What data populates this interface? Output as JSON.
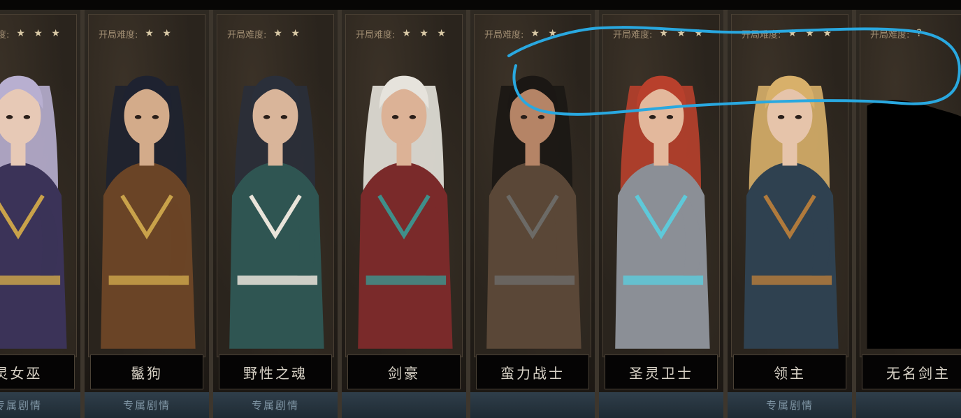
{
  "difficulty_label": "开局难度:",
  "cards": [
    {
      "name": "灵女巫",
      "stars": "★ ★ ★",
      "story": "专属剧情",
      "palette": {
        "hair": "#b8afd0",
        "cloth": "#3b3358",
        "skin": "#e7c9b6",
        "accent": "#c9a24a"
      }
    },
    {
      "name": "鬣狗",
      "stars": "★ ★",
      "story": "专属剧情",
      "palette": {
        "hair": "#1e2230",
        "cloth": "#6a4426",
        "skin": "#d3ab8a",
        "accent": "#c9a24a"
      }
    },
    {
      "name": "野性之魂",
      "stars": "★ ★",
      "story": "专属剧情",
      "palette": {
        "hair": "#2a2f3a",
        "cloth": "#2f5552",
        "skin": "#d9b59a",
        "accent": "#e9e4da"
      }
    },
    {
      "name": "剑豪",
      "stars": "★ ★ ★",
      "story": "",
      "palette": {
        "hair": "#e6e3dc",
        "cloth": "#7a2a2a",
        "skin": "#dcb296",
        "accent": "#3f8f8a"
      }
    },
    {
      "name": "蛮力战士",
      "stars": "★ ★",
      "story": "",
      "palette": {
        "hair": "#1b1714",
        "cloth": "#5a4737",
        "skin": "#b58466",
        "accent": "#6c6a66"
      }
    },
    {
      "name": "圣灵卫士",
      "stars": "★ ★ ★",
      "story": "",
      "palette": {
        "hair": "#b8402c",
        "cloth": "#8b8f96",
        "skin": "#e3b89c",
        "accent": "#5ec9d9"
      }
    },
    {
      "name": "领主",
      "stars": "★ ★ ★",
      "story": "专属剧情",
      "palette": {
        "hair": "#d8b06a",
        "cloth": "#2f4150",
        "skin": "#e6c4aa",
        "accent": "#b07a3c"
      }
    },
    {
      "name": "无名剑主",
      "stars": "?",
      "story": "",
      "palette": {
        "hair": "#000000",
        "cloth": "#000000",
        "skin": "#000000",
        "accent": "#000000"
      }
    }
  ],
  "annotation_color": "#29a8e0"
}
